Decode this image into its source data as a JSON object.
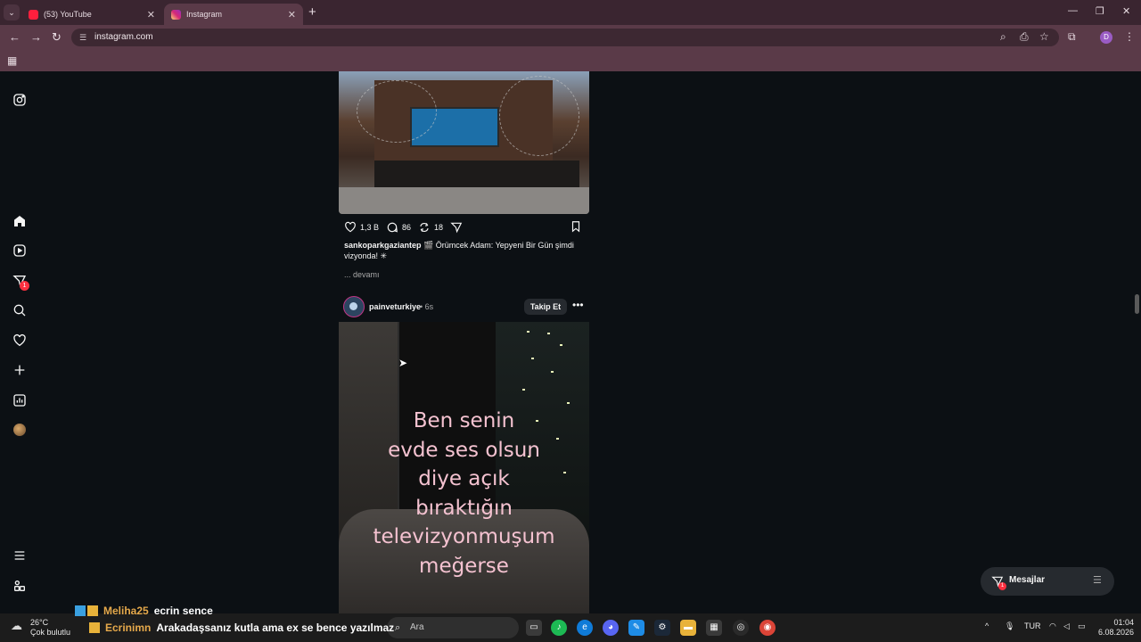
{
  "browser": {
    "tabs": [
      {
        "label": "(53) YouTube",
        "active": false
      },
      {
        "label": "Instagram",
        "active": true
      }
    ],
    "url": "instagram.com",
    "profile_initial": "D"
  },
  "post1": {
    "likes": "1,3 B",
    "comments": "86",
    "reposts": "18",
    "caption_user": "sankoparkgaziantep",
    "caption_text": "Örümcek Adam: Yepyeni Bir Gün şimdi vizyonda!",
    "more": "... devamı"
  },
  "post2": {
    "username": "painveturkiye",
    "time": "6s",
    "follow": "Takip Et",
    "overlay_lines": [
      "Ben senin",
      "evde ses olsun",
      "diye açık",
      "bıraktığın",
      "televizyonmuşum",
      "meğerse"
    ]
  },
  "sidenav": {
    "notification_badge": "1"
  },
  "messages": {
    "label": "Mesajlar",
    "badge": "1"
  },
  "chat": {
    "line1_user": "Meliha25",
    "line1_text": "ecrin sence",
    "line2_user": "Ecrinimn",
    "line2_text": "Arakadaşsanız kutla ama ex se bence yazılmaz",
    "colors": {
      "user1": "#e6a94b",
      "user2": "#e6a94b"
    }
  },
  "taskbar": {
    "temp": "26°C",
    "weather": "Çok bulutlu",
    "search_placeholder": "Ara",
    "lang": "TUR",
    "time": "01:04",
    "date": "6.08.2026"
  }
}
